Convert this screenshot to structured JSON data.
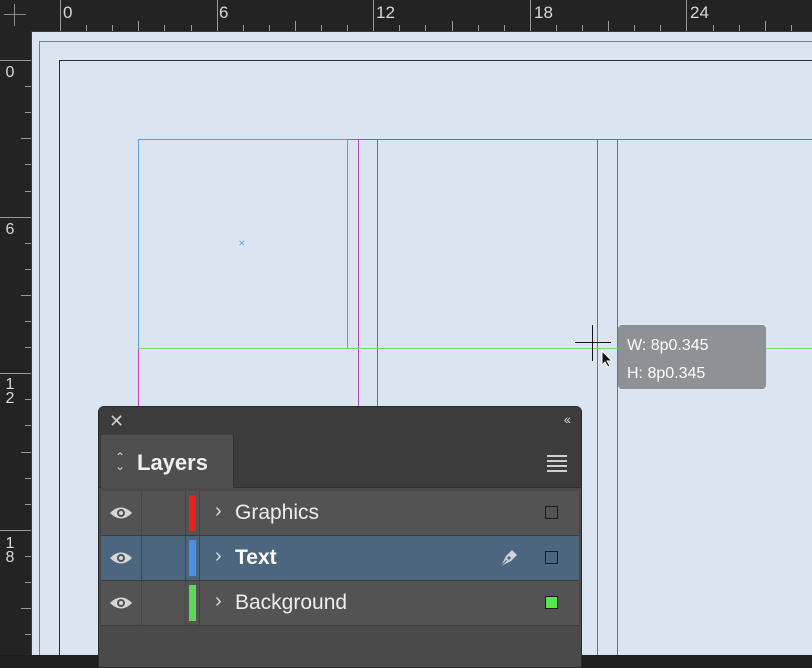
{
  "rulers": {
    "top_labels": [
      "0",
      "6",
      "12",
      "18",
      "24"
    ],
    "left_labels": [
      "0",
      "6",
      "1\n2",
      "1\n8"
    ]
  },
  "tooltip": {
    "width_text": "W: 8p0.345",
    "height_text": "H: 8p0.345"
  },
  "layers_panel": {
    "close_icon": "close-icon",
    "collapse_icon": "double-chevron-left-icon",
    "tab_label": "Layers",
    "menu_icon": "hamburger-menu-icon",
    "layers": [
      {
        "name": "Graphics",
        "color": "#e8211f",
        "selected": false,
        "swatch": "transparent"
      },
      {
        "name": "Text",
        "color": "#4b8fe0",
        "selected": true,
        "swatch": "transparent"
      },
      {
        "name": "Background",
        "color": "#5fd65a",
        "selected": false,
        "swatch": "#53e84c"
      }
    ]
  },
  "colors": {
    "margin_guide": "#c040d0",
    "bleed_guide": "#e0488c",
    "frame_edge": "#5b9be0",
    "smart_guide": "#7fd67a"
  }
}
